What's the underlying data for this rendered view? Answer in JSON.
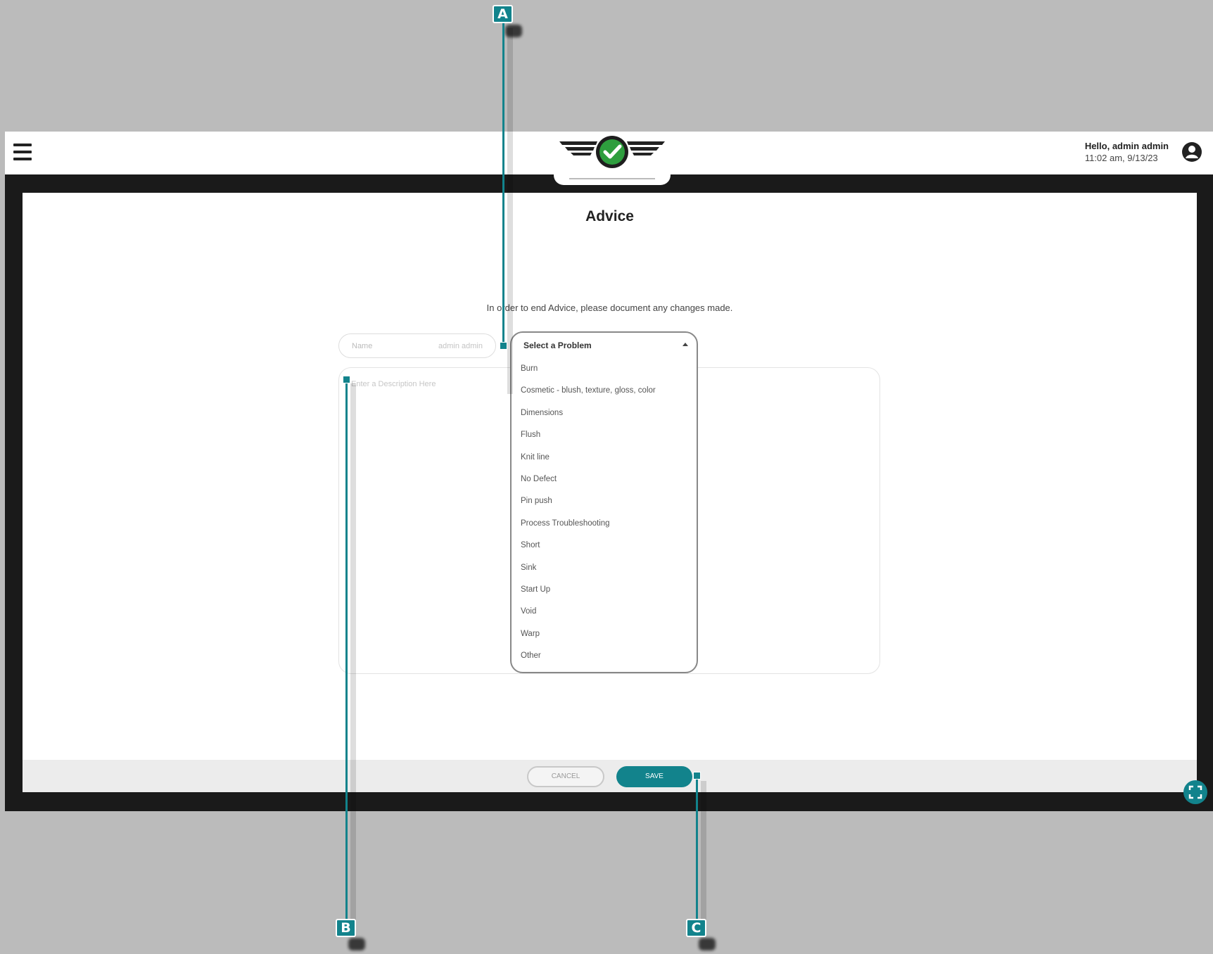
{
  "header": {
    "greeting": "Hello, admin admin",
    "datetime": "11:02 am, 9/13/23"
  },
  "page": {
    "title": "Advice",
    "instructions": "In order to end Advice, please document any changes made."
  },
  "form": {
    "name_label": "Name",
    "name_value": "admin admin",
    "description_placeholder": "Enter a Description Here",
    "problem_select": {
      "placeholder": "Select a Problem",
      "options": [
        "Burn",
        "Cosmetic - blush, texture, gloss, color",
        "Dimensions",
        "Flush",
        "Knit line",
        "No Defect",
        "Pin push",
        "Process Troubleshooting",
        "Short",
        "Sink",
        "Start Up",
        "Void",
        "Warp",
        "Other"
      ]
    }
  },
  "footer": {
    "cancel_label": "CANCEL",
    "save_label": "SAVE"
  },
  "callouts": [
    "A",
    "B",
    "C"
  ],
  "colors": {
    "accent": "#12838c",
    "logo_green": "#2e9e3e"
  }
}
